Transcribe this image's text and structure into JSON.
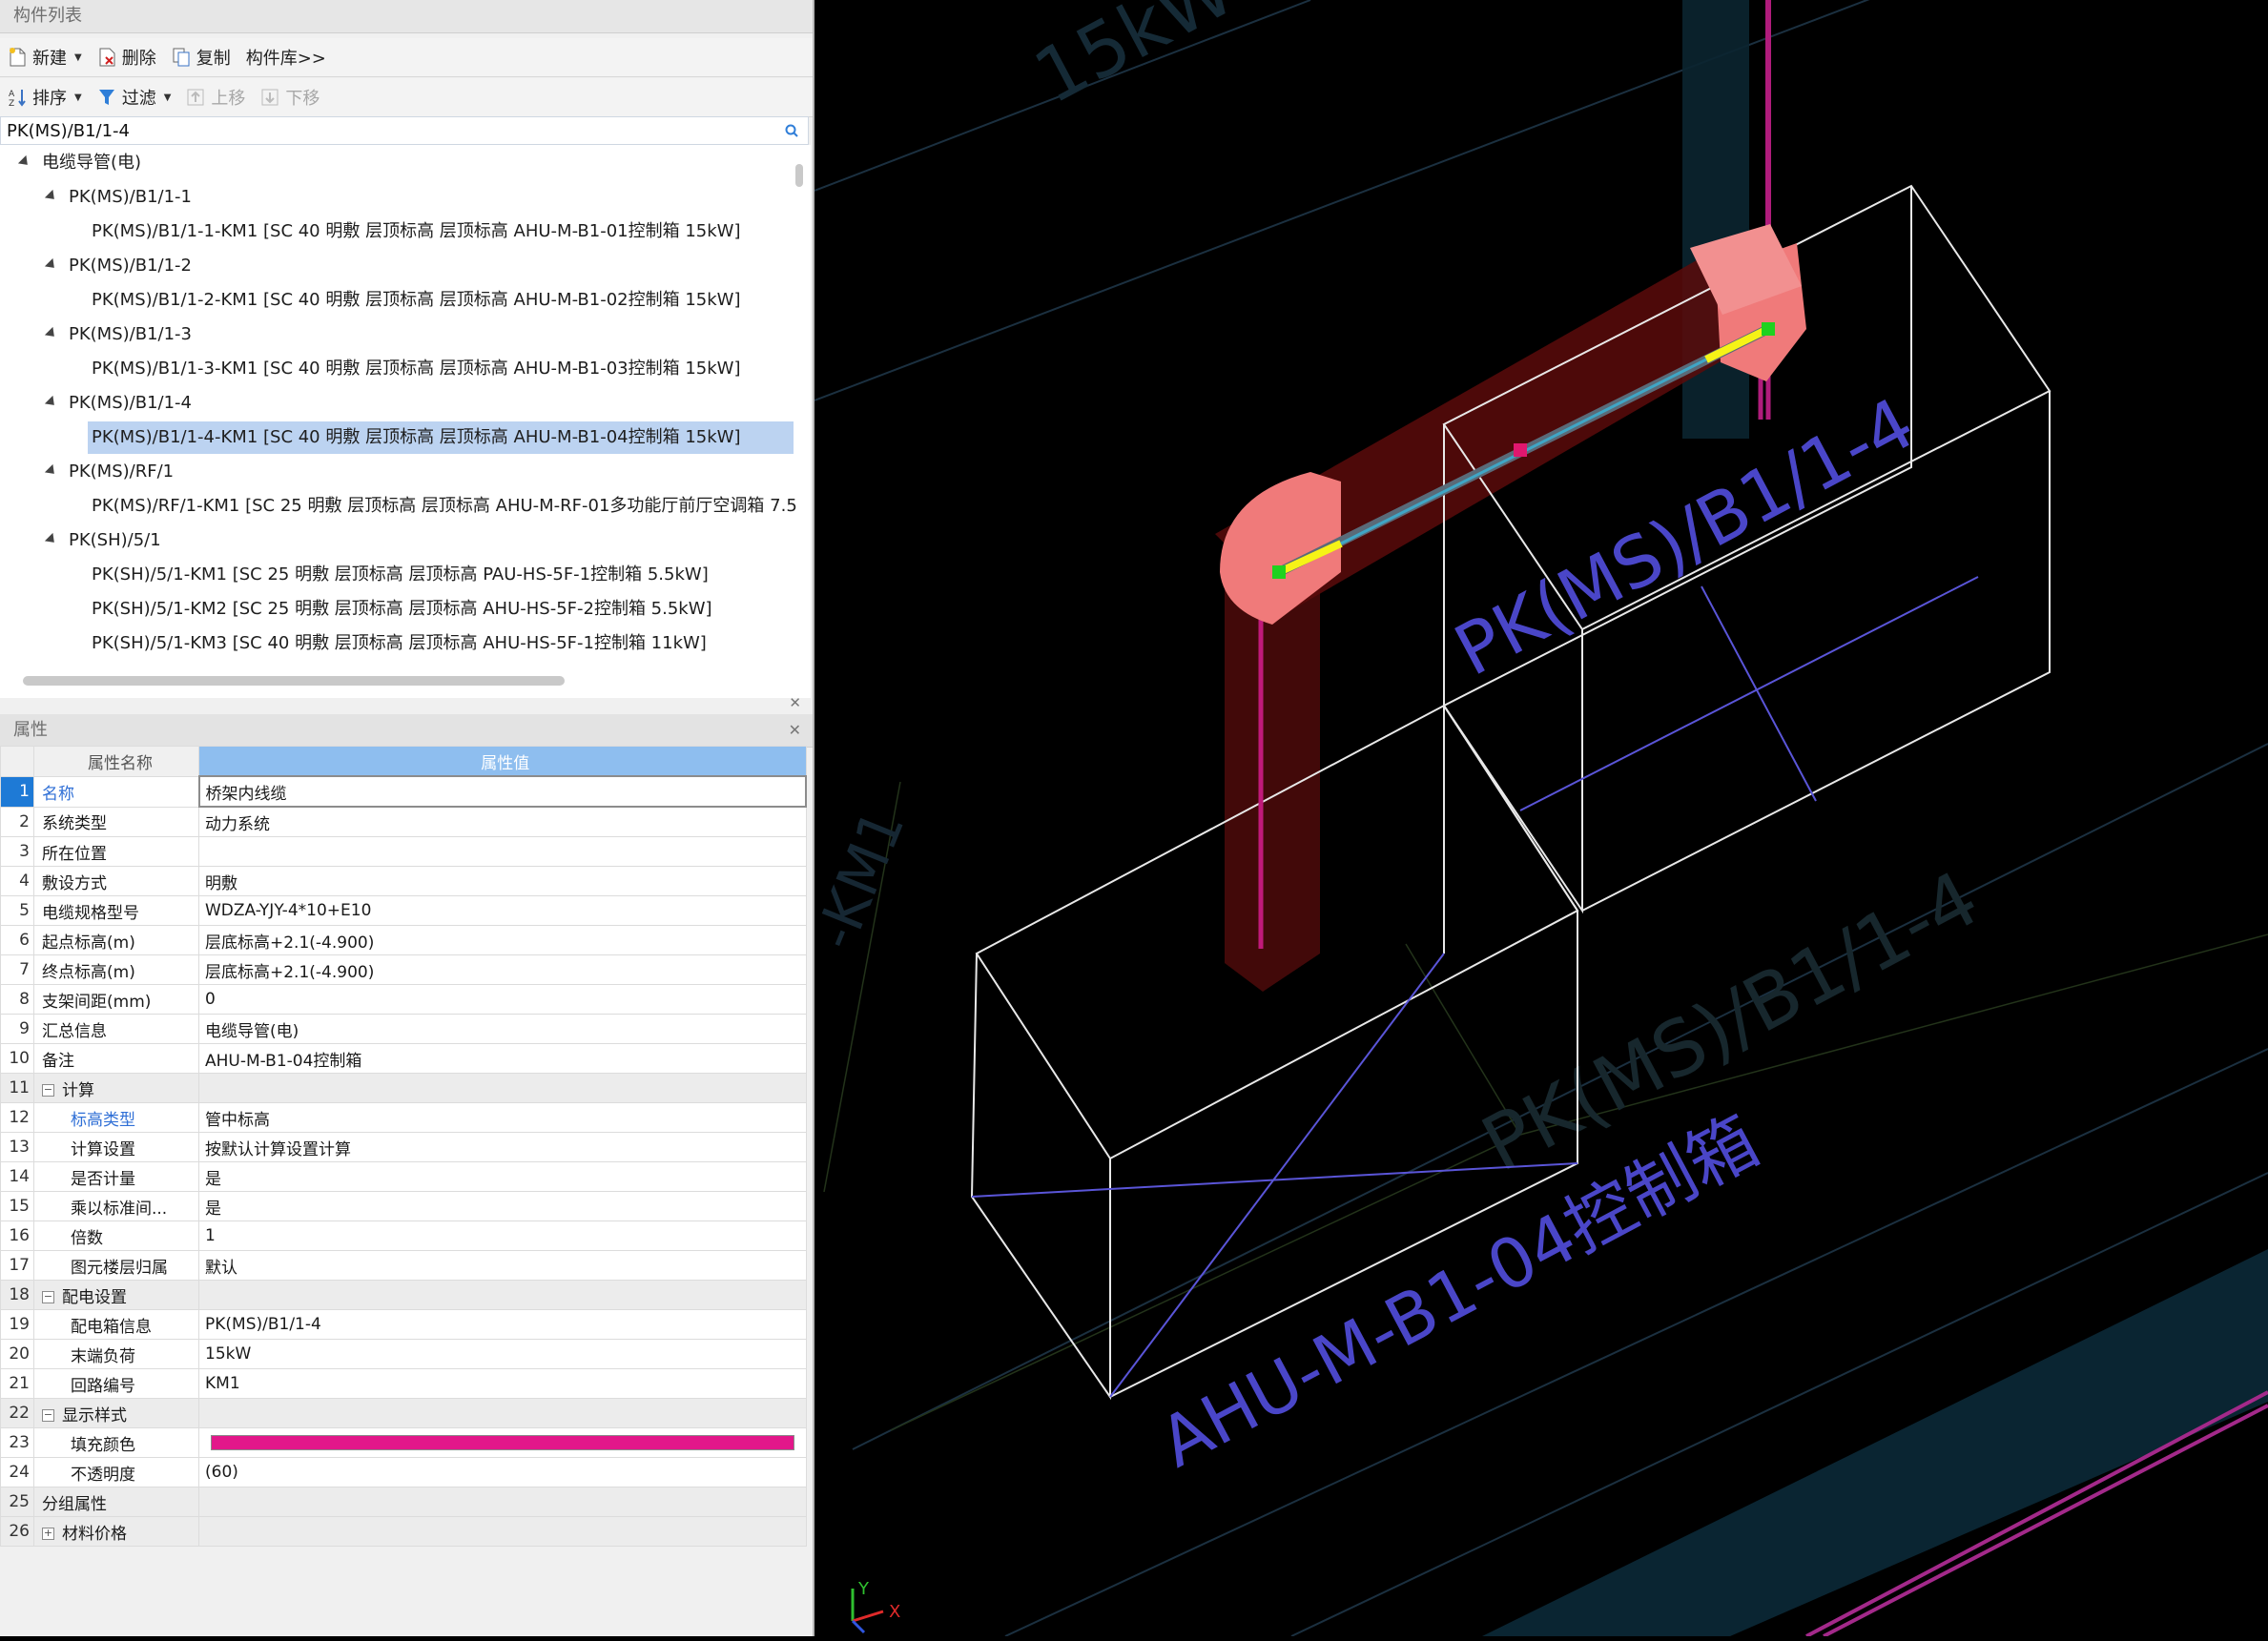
{
  "component_list": {
    "title": "构件列表",
    "toolbar1": {
      "new": "新建",
      "delete": "删除",
      "copy": "复制",
      "library": "构件库>>"
    },
    "toolbar2": {
      "sort": "排序",
      "filter": "过滤",
      "up": "上移",
      "down": "下移"
    },
    "search": {
      "value": "PK(MS)/B1/1-4"
    },
    "tree": [
      {
        "label": "电缆导管(电)",
        "level": 0,
        "toggle": true
      },
      {
        "label": "PK(MS)/B1/1-1",
        "level": 1,
        "toggle": true
      },
      {
        "label": "PK(MS)/B1/1-1-KM1 [SC 40 明敷 层顶标高 层顶标高 AHU-M-B1-01控制箱 15kW]",
        "level": 2
      },
      {
        "label": "PK(MS)/B1/1-2",
        "level": 1,
        "toggle": true
      },
      {
        "label": "PK(MS)/B1/1-2-KM1 [SC 40 明敷 层顶标高 层顶标高 AHU-M-B1-02控制箱 15kW]",
        "level": 2
      },
      {
        "label": "PK(MS)/B1/1-3",
        "level": 1,
        "toggle": true
      },
      {
        "label": "PK(MS)/B1/1-3-KM1 [SC 40 明敷 层顶标高 层顶标高 AHU-M-B1-03控制箱 15kW]",
        "level": 2
      },
      {
        "label": "PK(MS)/B1/1-4",
        "level": 1,
        "toggle": true
      },
      {
        "label": "PK(MS)/B1/1-4-KM1 [SC 40 明敷 层顶标高 层顶标高 AHU-M-B1-04控制箱 15kW]",
        "level": 2,
        "selected": true
      },
      {
        "label": "PK(MS)/RF/1",
        "level": 1,
        "toggle": true
      },
      {
        "label": "PK(MS)/RF/1-KM1 [SC 25 明敷 层顶标高 层顶标高 AHU-M-RF-01多功能厅前厅空调箱 7.5",
        "level": 2
      },
      {
        "label": "PK(SH)/5/1",
        "level": 1,
        "toggle": true
      },
      {
        "label": "PK(SH)/5/1-KM1 [SC 25 明敷 层顶标高 层顶标高 PAU-HS-5F-1控制箱 5.5kW]",
        "level": 2
      },
      {
        "label": "PK(SH)/5/1-KM2 [SC 25 明敷 层顶标高 层顶标高 AHU-HS-5F-2控制箱 5.5kW]",
        "level": 2
      },
      {
        "label": "PK(SH)/5/1-KM3 [SC 40 明敷 层顶标高 层顶标高 AHU-HS-5F-1控制箱 11kW]",
        "level": 2
      }
    ]
  },
  "properties": {
    "title": "属性",
    "header_name": "属性名称",
    "header_value": "属性值",
    "rows": [
      {
        "n": "1",
        "name": "名称",
        "value": "桥架内线缆"
      },
      {
        "n": "2",
        "name": "系统类型",
        "value": "动力系统"
      },
      {
        "n": "3",
        "name": "所在位置",
        "value": ""
      },
      {
        "n": "4",
        "name": "敷设方式",
        "value": "明敷"
      },
      {
        "n": "5",
        "name": "电缆规格型号",
        "value": "WDZA-YJY-4*10+E10"
      },
      {
        "n": "6",
        "name": "起点标高(m)",
        "value": "层底标高+2.1(-4.900)"
      },
      {
        "n": "7",
        "name": "终点标高(m)",
        "value": "层底标高+2.1(-4.900)"
      },
      {
        "n": "8",
        "name": "支架间距(mm)",
        "value": "0"
      },
      {
        "n": "9",
        "name": "汇总信息",
        "value": "电缆导管(电)"
      },
      {
        "n": "10",
        "name": "备注",
        "value": "AHU-M-B1-04控制箱"
      },
      {
        "n": "11",
        "name": "计算",
        "value": ""
      },
      {
        "n": "12",
        "name": "标高类型",
        "value": "管中标高"
      },
      {
        "n": "13",
        "name": "计算设置",
        "value": "按默认计算设置计算"
      },
      {
        "n": "14",
        "name": "是否计量",
        "value": "是"
      },
      {
        "n": "15",
        "name": "乘以标准间...",
        "value": "是"
      },
      {
        "n": "16",
        "name": "倍数",
        "value": "1"
      },
      {
        "n": "17",
        "name": "图元楼层归属",
        "value": "默认"
      },
      {
        "n": "18",
        "name": "配电设置",
        "value": ""
      },
      {
        "n": "19",
        "name": "配电箱信息",
        "value": "PK(MS)/B1/1-4"
      },
      {
        "n": "20",
        "name": "末端负荷",
        "value": "15kW"
      },
      {
        "n": "21",
        "name": "回路编号",
        "value": "KM1"
      },
      {
        "n": "22",
        "name": "显示样式",
        "value": ""
      },
      {
        "n": "23",
        "name": "填充颜色",
        "value": ""
      },
      {
        "n": "24",
        "name": "不透明度",
        "value": "(60)"
      },
      {
        "n": "25",
        "name": "分组属性",
        "value": ""
      },
      {
        "n": "26",
        "name": "材料价格",
        "value": ""
      }
    ],
    "fill_color": "#e2178a"
  },
  "viewport": {
    "labels": {
      "top": "15kW",
      "box_right": "PK(MS)/B1/1-4",
      "lower_right": "PK(MS)/B1/1-4",
      "box_front": "AHU-M-B1-04控制箱",
      "left_edge": "-KM1"
    },
    "axis": {
      "x": "X",
      "y": "Y"
    }
  }
}
